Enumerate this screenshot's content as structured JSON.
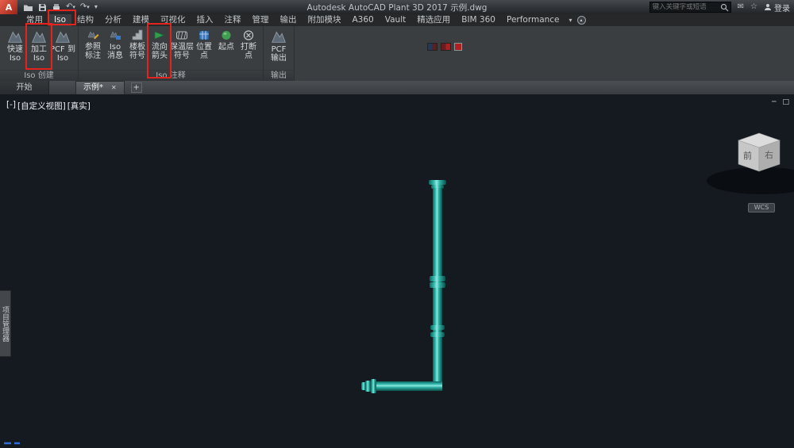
{
  "app": {
    "logo_letter": "A",
    "title_product": "Autodesk AutoCAD Plant 3D 2017",
    "title_file": "示例.dwg",
    "search_placeholder": "键入关键字或短语",
    "sign_in": "登录"
  },
  "icons": {
    "undo": "↶",
    "redo": "↷",
    "caret": "▾",
    "caret_up": "▴",
    "close": "✕",
    "plus": "+",
    "minimize": "─",
    "restore": "□",
    "star": "☆",
    "mail": "✉"
  },
  "ribbon": {
    "tabs": [
      {
        "label": "常用"
      },
      {
        "label": "Iso"
      },
      {
        "label": "结构"
      },
      {
        "label": "分析"
      },
      {
        "label": "建模"
      },
      {
        "label": "可视化"
      },
      {
        "label": "插入"
      },
      {
        "label": "注释"
      },
      {
        "label": "管理"
      },
      {
        "label": "输出"
      },
      {
        "label": "附加模块"
      },
      {
        "label": "A360"
      },
      {
        "label": "Vault"
      },
      {
        "label": "精选应用"
      },
      {
        "label": "BIM 360"
      },
      {
        "label": "Performance"
      }
    ],
    "panels": {
      "create": {
        "label": "Iso 创建",
        "buttons": [
          {
            "l1": "快速",
            "l2": "Iso"
          },
          {
            "l1": "加工",
            "l2": "Iso"
          },
          {
            "l1": "PCF 到",
            "l2": "Iso"
          }
        ]
      },
      "annotate": {
        "label": "Iso 注释",
        "buttons": [
          {
            "l1": "参照",
            "l2": "标注"
          },
          {
            "l1": "Iso",
            "l2": "消息"
          },
          {
            "l1": "楼板",
            "l2": "符号"
          },
          {
            "l1": "流向",
            "l2": "箭头"
          },
          {
            "l1": "保温层",
            "l2": "符号"
          },
          {
            "l1": "位置",
            "l2": "点"
          },
          {
            "l1": "起点",
            "l2": ""
          },
          {
            "l1": "打断",
            "l2": "点"
          }
        ]
      },
      "output": {
        "label": "输出",
        "buttons": [
          {
            "l1": "PCF",
            "l2": "输出"
          }
        ]
      }
    }
  },
  "file_tabs": {
    "start": "开始",
    "drawing": "示例*"
  },
  "viewport": {
    "pane_control": "[-]",
    "view_name": "[自定义视图]",
    "visual_style": "[真实]",
    "wcs": "WCS",
    "project_manager": "项目管理器",
    "viewcube": {
      "front": "前",
      "right": "右"
    }
  },
  "colors": {
    "pipe_teal": "#2fb3a8",
    "annotation_red": "#e3231d",
    "viewport_bg": "#151a21"
  }
}
